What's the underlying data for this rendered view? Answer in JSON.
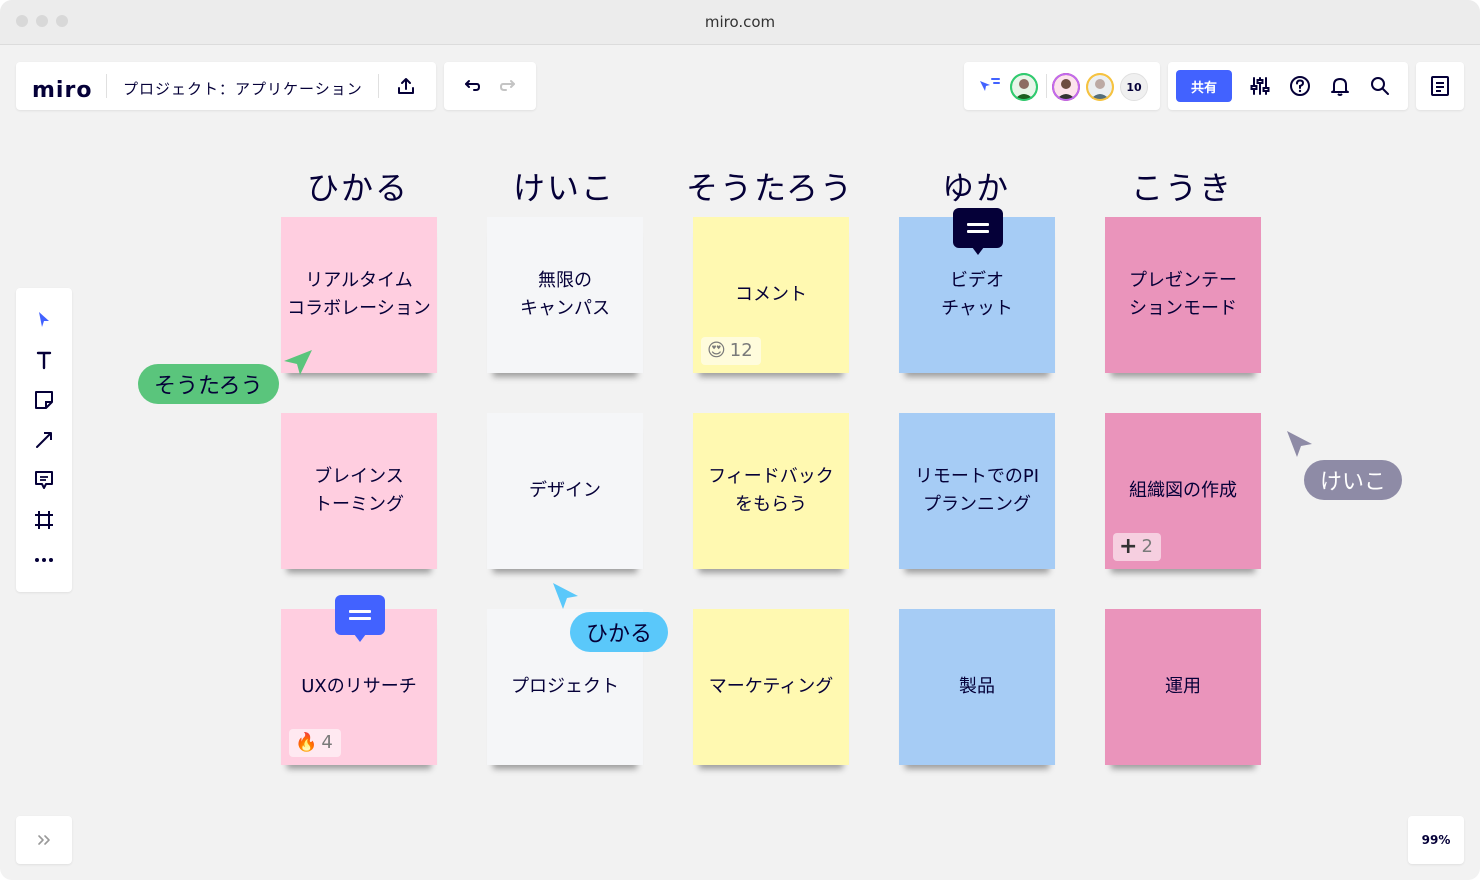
{
  "browser": {
    "url": "miro.com"
  },
  "header": {
    "logo": "miro",
    "board_title": "プロジェクト：アプリケーション"
  },
  "collab": {
    "share_label": "共有",
    "participants_count": "10"
  },
  "columns": [
    "ひかる",
    "けいこ",
    "そうたろう",
    "ゆか",
    "こうき"
  ],
  "notes": [
    {
      "text": "リアルタイム\nコラボレーション",
      "color": "#ffcee0"
    },
    {
      "text": "無限の\nキャンパス",
      "color": "#f5f6f8"
    },
    {
      "text": "コメント",
      "color": "#fff9b1",
      "reaction": {
        "emoji": "😍",
        "count": "12"
      }
    },
    {
      "text": "ビデオ\nチャット",
      "color": "#a6ccf5"
    },
    {
      "text": "プレゼンテー\nションモード",
      "color": "#ea94bb"
    },
    {
      "text": "ブレインス\nトーミング",
      "color": "#ffcee0"
    },
    {
      "text": "デザイン",
      "color": "#f5f6f8"
    },
    {
      "text": "フィードバック\nをもらう",
      "color": "#fff9b1"
    },
    {
      "text": "リモートでのPI\nプランニング",
      "color": "#a6ccf5"
    },
    {
      "text": "組織図の作成",
      "color": "#ea94bb",
      "reaction": {
        "emoji": "+",
        "count": "2"
      }
    },
    {
      "text": "UXのリサーチ",
      "color": "#ffcee0",
      "reaction": {
        "emoji": "🔥",
        "count": "4"
      }
    },
    {
      "text": "プロジェクト",
      "color": "#f5f6f8"
    },
    {
      "text": "マーケティング",
      "color": "#fff9b1"
    },
    {
      "text": "製品",
      "color": "#a6ccf5"
    },
    {
      "text": "運用",
      "color": "#ea94bb"
    }
  ],
  "cursors": [
    {
      "name": "そうたろう",
      "color": "#5ac57c"
    },
    {
      "name": "ひかる",
      "color": "#5ac8fa"
    },
    {
      "name": "けいこ",
      "color": "#8e8ba6"
    }
  ],
  "zoom": "99%",
  "colors": {
    "accent": "#4262ff",
    "text": "#050038"
  }
}
